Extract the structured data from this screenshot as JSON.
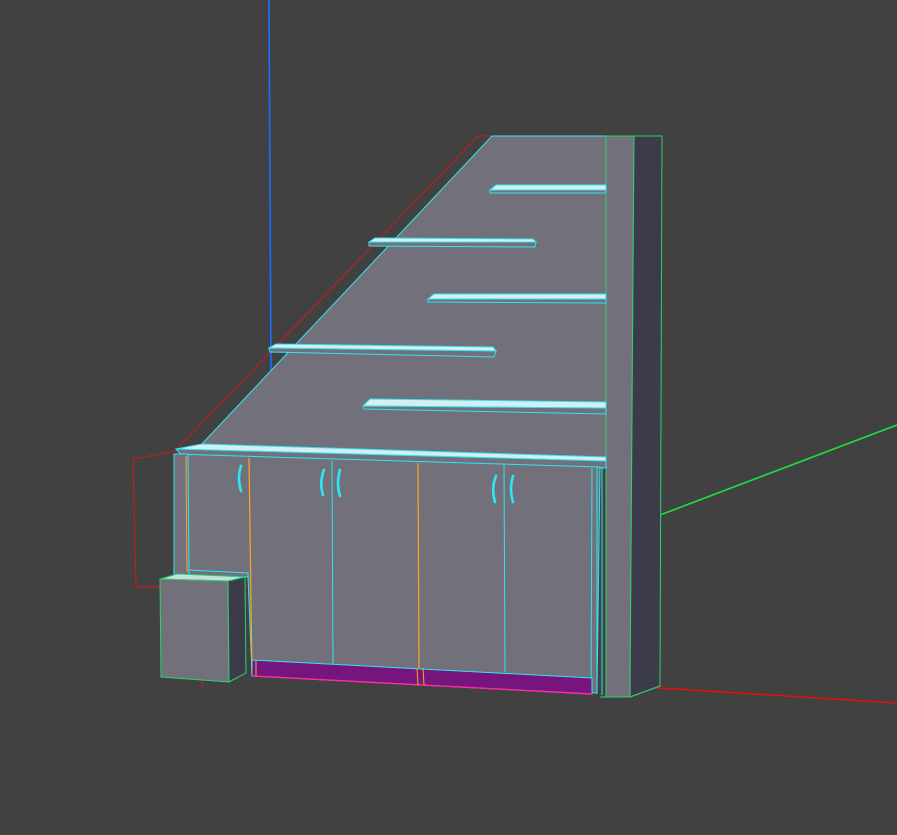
{
  "viewport": {
    "background_color": "#414141"
  },
  "axes": {
    "x_color": "#e01010",
    "y_color": "#18e040",
    "z_color": "#1a6fff"
  },
  "model": {
    "face_color": "#72717b",
    "side_color": "#3c3b4a",
    "selection_edge_color": "#2ee6f0",
    "group_edge_color": "#2fd16b",
    "highlight_edge_color": "#ffa41b",
    "bounding_box_color": "#d01818",
    "plinth_color": "#76157d",
    "plinth_edge_color": "#ff2aa0",
    "shelf_top_color": "#d6eef2",
    "handle_color": "#2ee6f0"
  }
}
